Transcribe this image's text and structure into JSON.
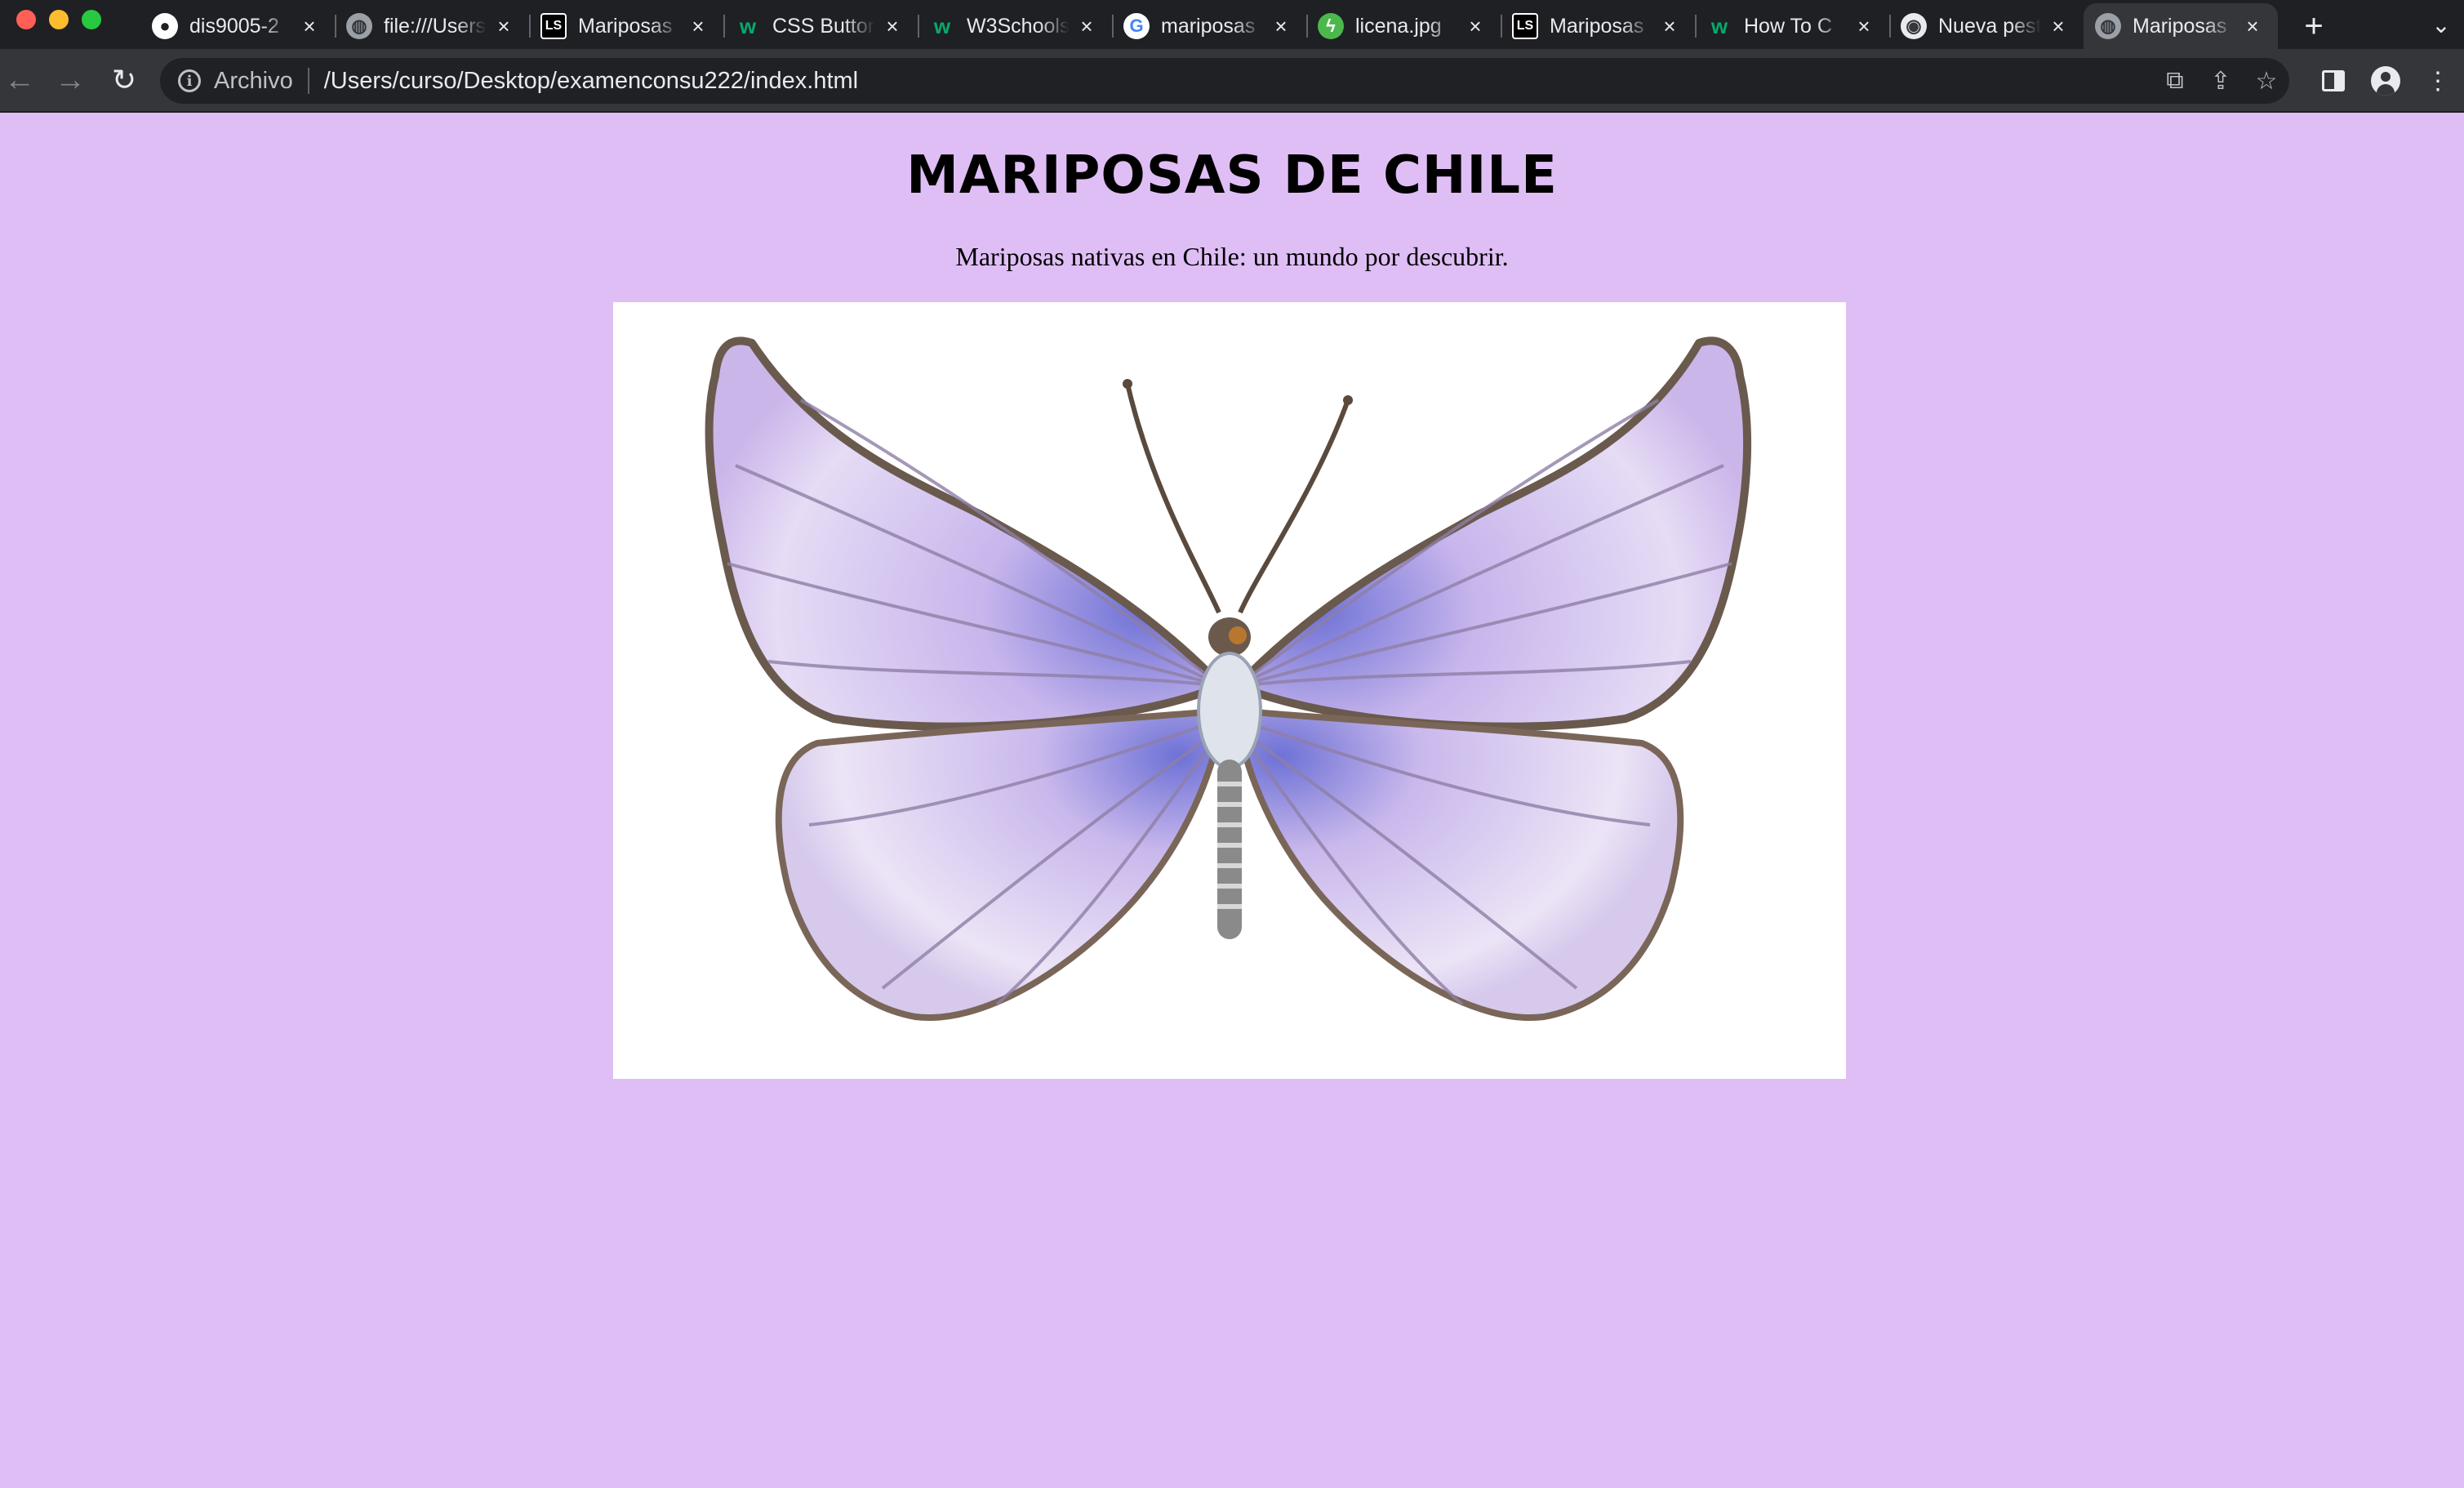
{
  "browser": {
    "tabs": [
      {
        "title": "dis9005-2",
        "icon": "github-icon",
        "active": false
      },
      {
        "title": "file:///Users",
        "icon": "globe-icon",
        "active": false
      },
      {
        "title": "Mariposas",
        "icon": "ls-icon",
        "active": false
      },
      {
        "title": "CSS Buttons",
        "icon": "w3schools-icon",
        "active": false
      },
      {
        "title": "W3Schools",
        "icon": "w3schools-icon",
        "active": false
      },
      {
        "title": "mariposas",
        "icon": "google-icon",
        "active": false
      },
      {
        "title": "licena.jpg",
        "icon": "green-bolt-icon",
        "active": false
      },
      {
        "title": "Mariposas",
        "icon": "ls-icon",
        "active": false
      },
      {
        "title": "How To C",
        "icon": "w3schools-icon",
        "active": false
      },
      {
        "title": "Nueva pesta",
        "icon": "chrome-icon",
        "active": false
      },
      {
        "title": "Mariposas",
        "icon": "globe-icon",
        "active": true
      }
    ],
    "security_label": "Archivo",
    "url": "/Users/curso/Desktop/examenconsu222/index.html"
  },
  "page": {
    "title": "MARIPOSAS DE CHILE",
    "subtitle": "Mariposas nativas en Chile: un mundo por descubrir.",
    "background_color": "#dfbef5"
  }
}
